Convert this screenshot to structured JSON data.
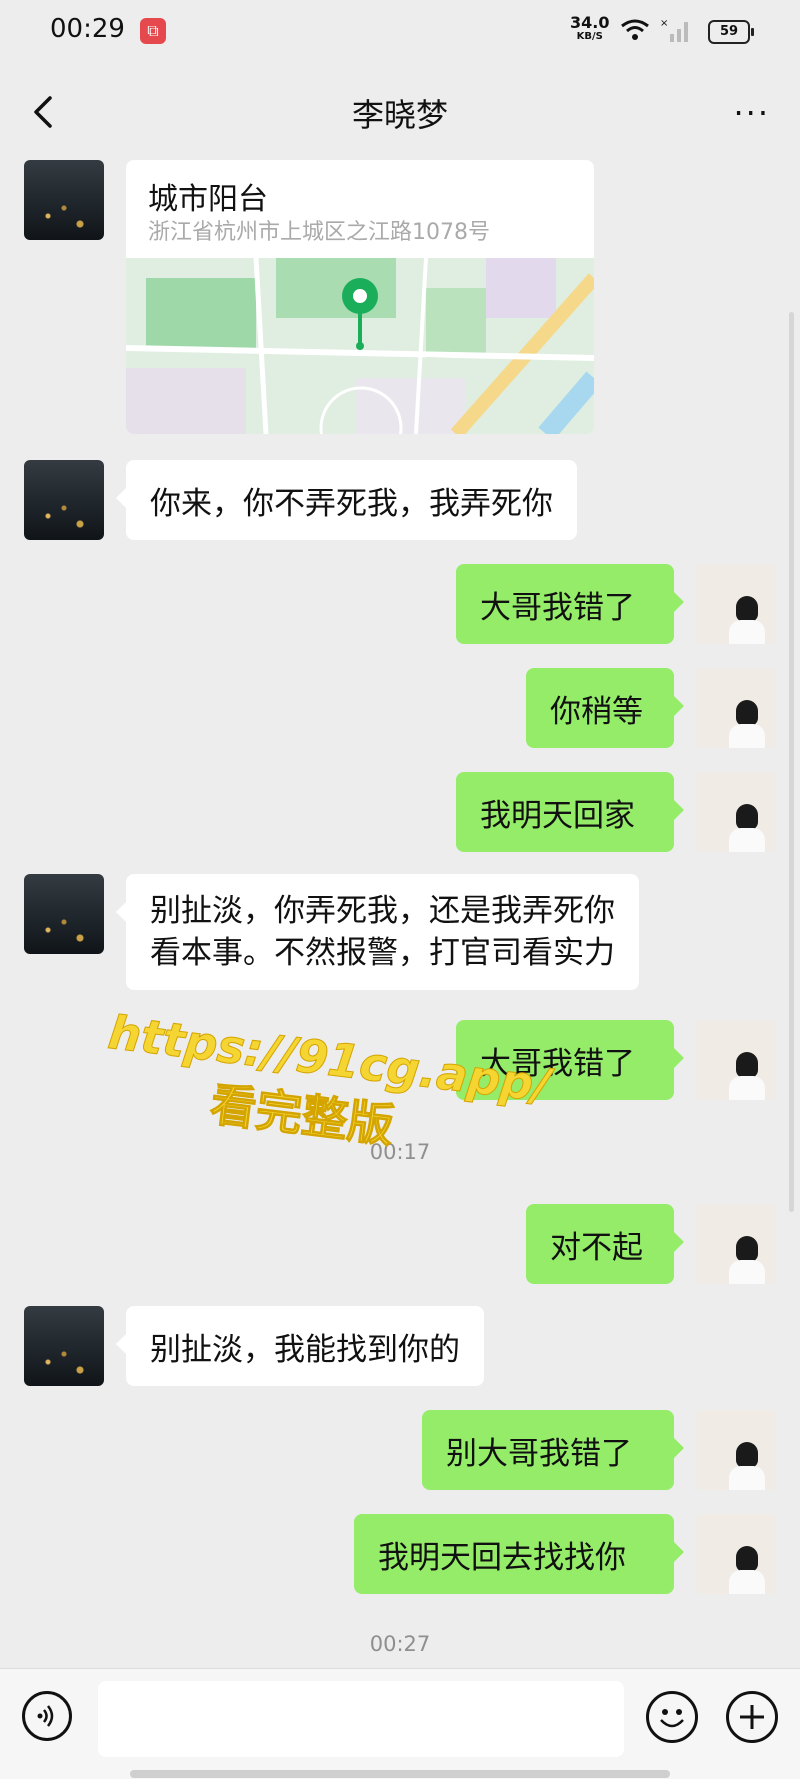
{
  "status_bar": {
    "time": "00:29",
    "net_speed_value": "34.0",
    "net_speed_unit": "KB/S",
    "battery": "59"
  },
  "header": {
    "title": "李晓梦",
    "more_label": "···"
  },
  "location_card": {
    "name": "城市阳台",
    "address": "浙江省杭州市上城区之江路1078号"
  },
  "messages": [
    {
      "side": "left",
      "text": "你来，你不弄死我，我弄死你"
    },
    {
      "side": "right",
      "text": "大哥我错了"
    },
    {
      "side": "right",
      "text": "你稍等"
    },
    {
      "side": "right",
      "text": "我明天回家"
    },
    {
      "side": "left",
      "line1": "别扯淡，你弄死我，还是我弄死你",
      "line2": "看本事。不然报警，打官司看实力"
    },
    {
      "side": "right",
      "text": "大哥我错了"
    },
    {
      "side": "right",
      "text": "对不起"
    },
    {
      "side": "left",
      "text": "别扯淡，我能找到你的"
    },
    {
      "side": "right",
      "text": "别大哥我错了"
    },
    {
      "side": "right",
      "text": "我明天回去找找你"
    }
  ],
  "timestamps": [
    "00:17",
    "00:27"
  ],
  "watermark": {
    "line1": "https://91cg.app/",
    "line2": "看完整版"
  },
  "input": {
    "value": ""
  },
  "colors": {
    "background": "#ededed",
    "outgoing_bubble": "#95ec69",
    "incoming_bubble": "#ffffff",
    "watermark": "#f5d531"
  },
  "icons": [
    "back-arrow-icon",
    "more-icon",
    "wifi-icon",
    "signal-icon",
    "battery-icon",
    "voice-icon",
    "emoji-icon",
    "plus-icon",
    "map-pin-icon"
  ]
}
